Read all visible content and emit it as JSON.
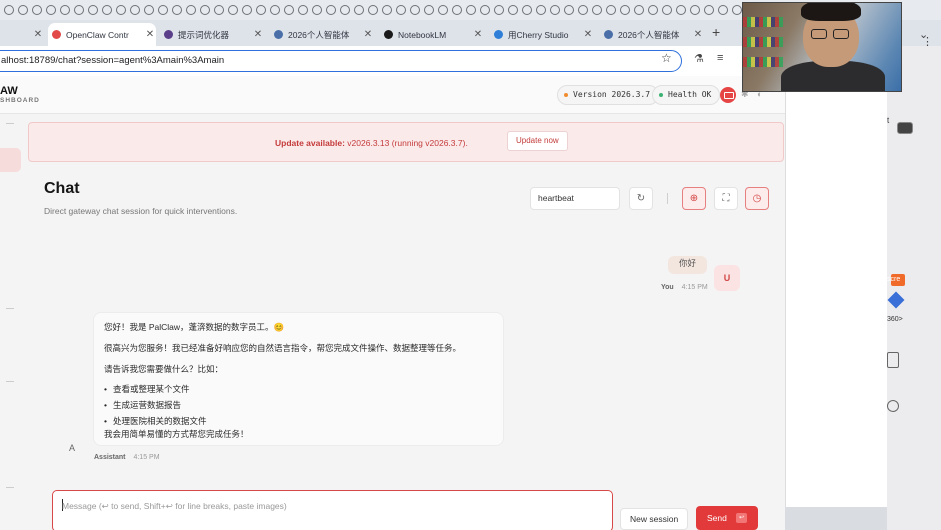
{
  "tabs": [
    {
      "title": "OpenClaw Contr",
      "active": true,
      "favicon_color": "#e24a4a"
    },
    {
      "title": "提示词优化器",
      "active": false,
      "favicon_color": "#5a3e8a"
    },
    {
      "title": "2026个人智能体",
      "active": false,
      "favicon_color": "#4a6fa8"
    },
    {
      "title": "NotebookLM",
      "active": false,
      "favicon_color": "#1a1a1a"
    },
    {
      "title": "用Cherry Studio",
      "active": false,
      "favicon_color": "#2f7fd8"
    },
    {
      "title": "2026个人智能体",
      "active": false,
      "favicon_color": "#4a6fa8"
    }
  ],
  "address_bar": {
    "url": "alhost:18789/chat?session=agent%3Amain%3Amain"
  },
  "app": {
    "brand": "AW",
    "brand_sub": "SHBOARD",
    "version": "Version 2026.3.7",
    "health": "Health OK",
    "colors": {
      "accent": "#e23a3a",
      "version_dot": "#f08c2e",
      "health_dot": "#3bb273"
    }
  },
  "banner": {
    "label": "Update available:",
    "detail": "v2026.3.13 (running v2026.3.7).",
    "button": "Update now"
  },
  "chat": {
    "title": "Chat",
    "subtitle": "Direct gateway chat session for quick interventions.",
    "session": "heartbeat",
    "messages": {
      "user": {
        "text": "你好",
        "avatar": "U",
        "sender": "You",
        "time": "4:15 PM"
      },
      "assistant": {
        "greeting": "您好！我是 PalClaw，蓬渀数据的数字员工。😊",
        "intro": "很高兴为您服务！我已经准备好响应您的自然语言指令，帮您完成文件操作、数据整理等任务。",
        "prompt": "请告诉我您需要做什么？比如：",
        "bullets": [
          "查看或整理某个文件",
          "生成运营数据报告",
          "处理医院相关的数据文件"
        ],
        "closing": "我会用简单易懂的方式帮您完成任务！",
        "avatar": "A",
        "sender": "Assistant",
        "time": "4:15 PM"
      }
    },
    "composer": {
      "placeholder": "Message (↩ to send, Shift+↩ for line breaks, paste images)"
    },
    "new_session": "New session",
    "send": "Send",
    "send_kbd": "↩"
  },
  "side_window": {
    "fragments": [
      "scre",
      "360>"
    ]
  }
}
